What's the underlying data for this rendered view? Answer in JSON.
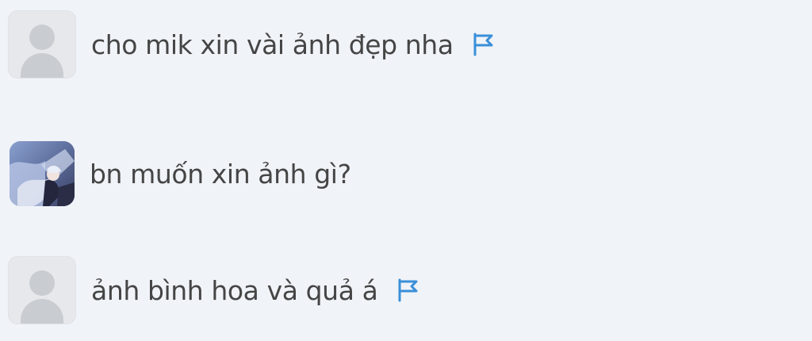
{
  "comments": [
    {
      "text": "cho mik xin vài ảnh đẹp nha",
      "avatar": "default-avatar",
      "has_report_flag": true
    },
    {
      "text": "bn muốn xin ảnh gì?",
      "avatar": "anime-photo-avatar",
      "has_report_flag": false
    },
    {
      "text": "ảnh bình hoa và quả á",
      "avatar": "default-avatar",
      "has_report_flag": true
    }
  ],
  "colors": {
    "background": "#f0f3f8",
    "text": "#454545",
    "flag": "#3a8fd8",
    "default_avatar_bg": "#e6e8ec",
    "default_avatar_silhouette": "#c9ccd1"
  },
  "icons": {
    "report": "flag-icon",
    "default_avatar": "user-silhouette-icon"
  }
}
